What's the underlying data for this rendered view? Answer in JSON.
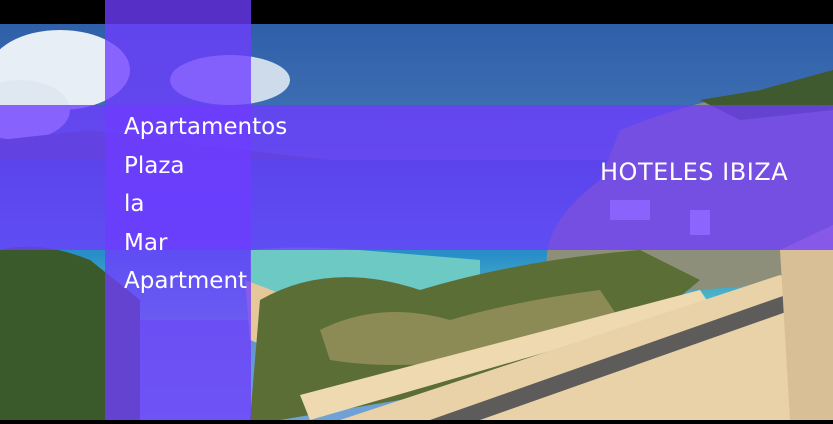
{
  "hotel": {
    "name_lines": [
      "Apartamentos",
      "Plaza",
      "la",
      "Mar",
      "Apartment"
    ]
  },
  "category_label": "HOTELES IBIZA",
  "colors": {
    "overlay": "#6e3cff",
    "sea": "#1f7fc4",
    "sky": "#4a86c8",
    "text": "#ffffff"
  }
}
